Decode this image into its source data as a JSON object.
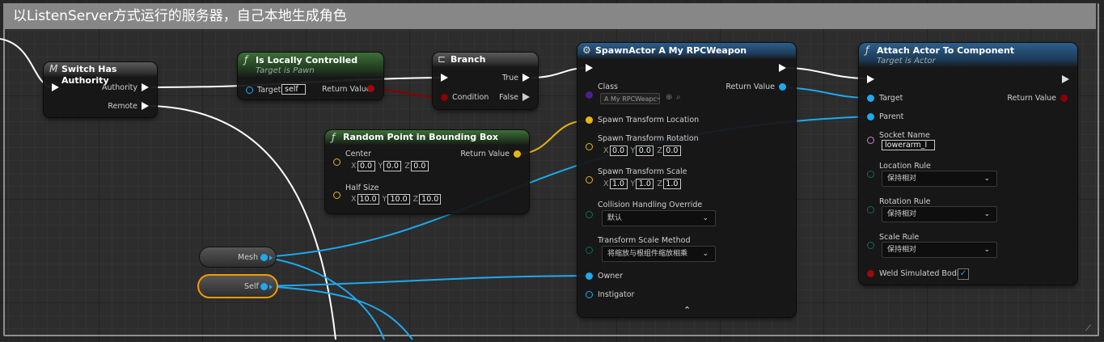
{
  "comment": {
    "title": "以ListenServer方式运行的服务器，自己本地生成角色"
  },
  "colors": {
    "exec": "#ffffff",
    "object": "#1ea9ef",
    "boolean": "#9c0a0a",
    "vector": "#e7b417",
    "class": "#8a5bd0",
    "enum": "#0f6a5a",
    "selection": "#f59a00"
  },
  "switch_node": {
    "title": "Switch Has Authority",
    "icon": "macro-icon",
    "icon_glyph": "M",
    "authority": "Authority",
    "remote": "Remote"
  },
  "locally_node": {
    "title": "Is Locally Controlled",
    "subtitle": "Target is Pawn",
    "target": "Target",
    "target_value": "self",
    "return": "Return Value"
  },
  "branch_node": {
    "title": "Branch",
    "true": "True",
    "condition": "Condition",
    "false": "False"
  },
  "random_node": {
    "title": "Random Point in Bounding Box",
    "center": "Center",
    "center_vec": {
      "x": "0.0",
      "y": "0.0",
      "z": "0.0"
    },
    "half_size": "Half Size",
    "half_vec": {
      "x": "10.0",
      "y": "10.0",
      "z": "10.0"
    },
    "return": "Return Value"
  },
  "spawn_node": {
    "title": "SpawnActor A My RPCWeapon",
    "class": "Class",
    "class_value": "A My RPCWeapc",
    "return": "Return Value",
    "location": "Spawn Transform Location",
    "rotation": "Spawn Transform Rotation",
    "rotation_vec": {
      "x": "0.0",
      "y": "0.0",
      "z": "0.0"
    },
    "scale": "Spawn Transform Scale",
    "scale_vec": {
      "x": "1.0",
      "y": "1.0",
      "z": "1.0"
    },
    "collision": "Collision Handling Override",
    "collision_value": "默认",
    "scale_method": "Transform Scale Method",
    "scale_method_value": "将缩放与根组件缩放相乘",
    "owner": "Owner",
    "instigator": "Instigator",
    "expand_icon": "chevron-up-icon"
  },
  "attach_node": {
    "title": "Attach Actor To Component",
    "subtitle": "Target is Actor",
    "target": "Target",
    "return": "Return Value",
    "parent": "Parent",
    "socket": "Socket Name",
    "socket_value": "lowerarm_l",
    "location_rule": "Location Rule",
    "location_value": "保持相对",
    "rotation_rule": "Rotation Rule",
    "rotation_value": "保持相对",
    "scale_rule": "Scale Rule",
    "scale_value": "保持相对",
    "weld": "Weld Simulated Bodies",
    "weld_checked": true
  },
  "mesh_var": {
    "label": "Mesh"
  },
  "self_var": {
    "label": "Self"
  },
  "axes": {
    "x": "X",
    "y": "Y",
    "z": "Z"
  }
}
